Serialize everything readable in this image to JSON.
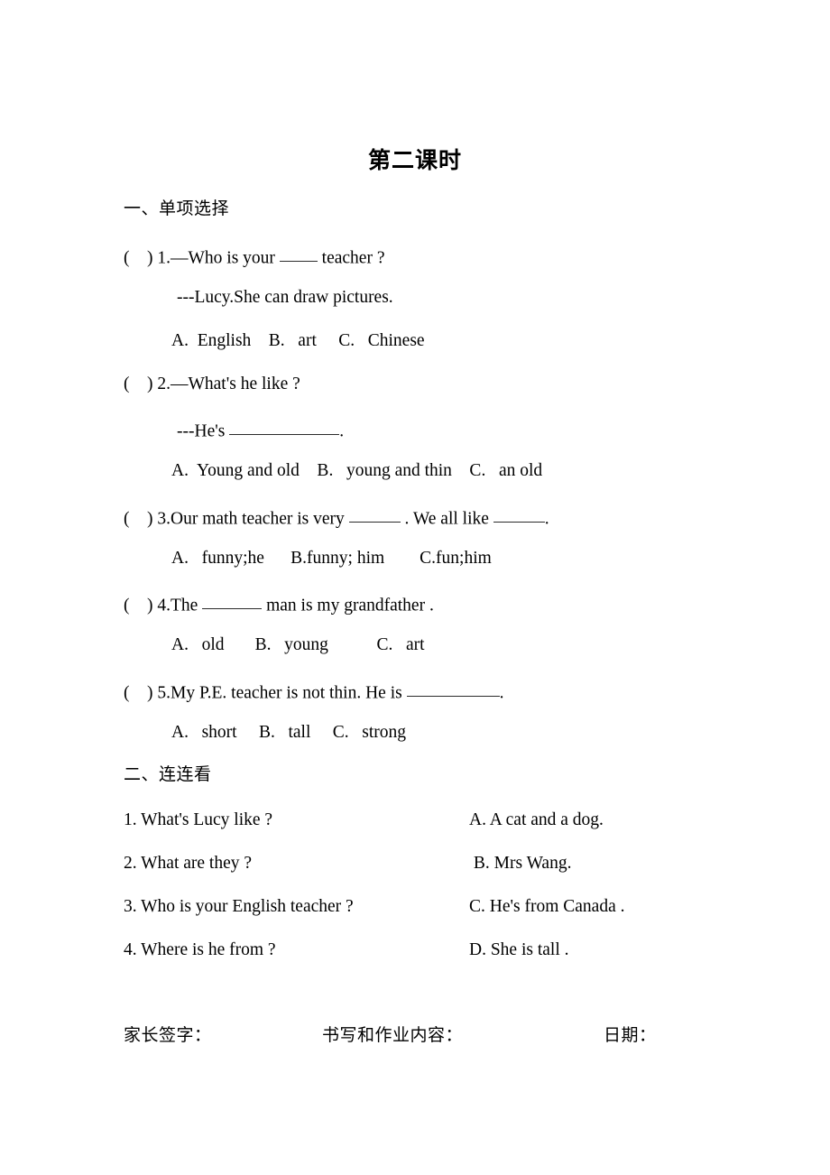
{
  "document": {
    "title": "第二课时",
    "sections": [
      {
        "heading": "一、单项选择",
        "questions": [
          {
            "marker": "(    ) 1.",
            "stem_before": "—Who is your ",
            "stem_after": " teacher ?",
            "sub_line": "---Lucy.She can draw pictures.",
            "options": "A.  English    B.   art     C.   Chinese"
          },
          {
            "marker": "(    ) 2.",
            "stem_before": "—What's he like ?",
            "stem_after": "",
            "sub_line_before": "---He's ",
            "sub_line_after": ".",
            "options": "A.  Young and old    B.   young and thin    C.   an old"
          },
          {
            "marker": "(    ) 3.",
            "stem_before": "Our math teacher is very ",
            "stem_middle": " . We all like ",
            "stem_after": ".",
            "options": "A.   funny;he      B.funny; him        C.fun;him"
          },
          {
            "marker": "(    ) 4.",
            "stem_before": "The ",
            "stem_after": " man is my grandfather .",
            "options": "A.   old       B.   young           C.   art"
          },
          {
            "marker": "(    ) 5.",
            "stem_before": "My P.E. teacher is not thin. He is ",
            "stem_after": ".",
            "options": "A.   short     B.   tall     C.   strong"
          }
        ]
      },
      {
        "heading": "二、连连看",
        "match_left": [
          "1. What's Lucy like ?",
          "2. What are they ?",
          "3. Who is your English teacher ?",
          "4. Where is he from ?"
        ],
        "match_right": [
          "A. A cat and a dog.",
          " B. Mrs Wang.",
          "C. He's from Canada .",
          "D. She is tall ."
        ]
      }
    ],
    "footer": {
      "parent_signature": "家长签字：",
      "homework_content": "书写和作业内容：",
      "date": "日期："
    }
  }
}
